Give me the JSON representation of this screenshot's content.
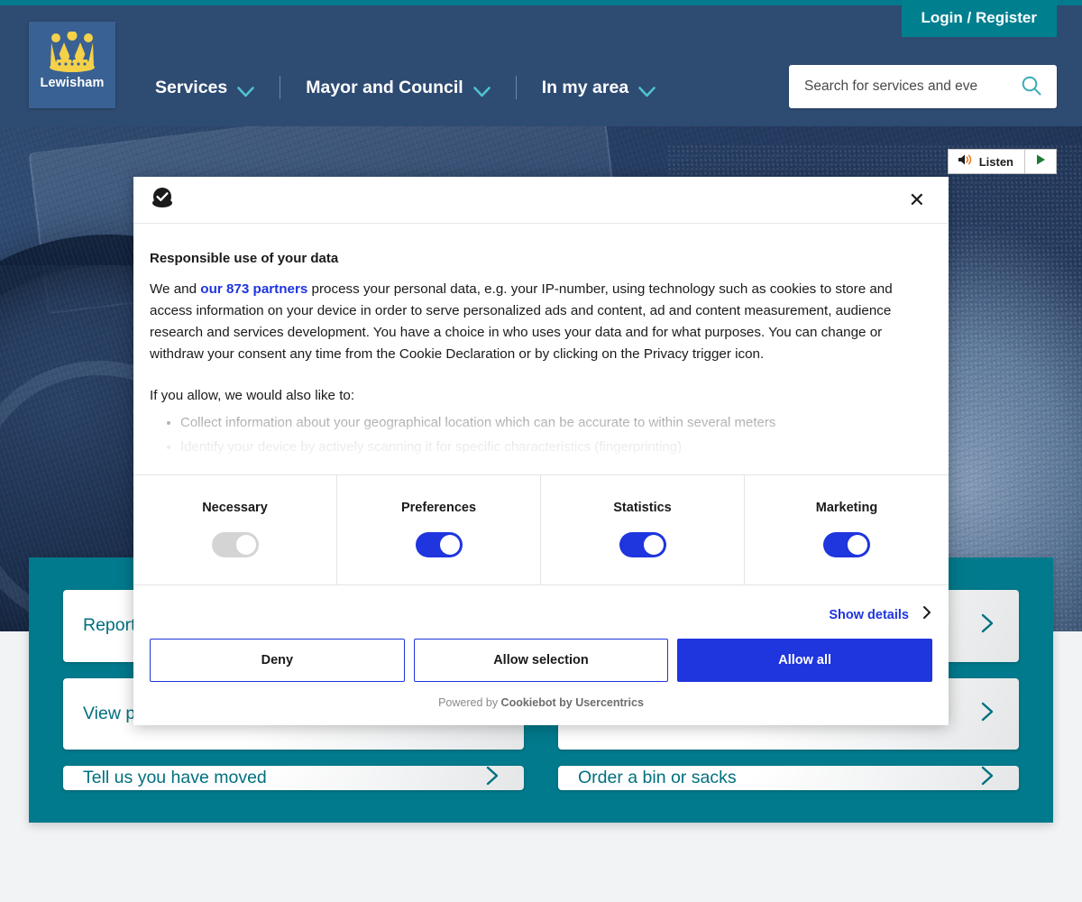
{
  "site": {
    "logo_text": "Lewisham",
    "logo_icon": "crown-icon"
  },
  "header": {
    "login_label": "Login / Register",
    "nav_items": [
      {
        "label": "Services",
        "icon": "chevron-down-icon"
      },
      {
        "label": "Mayor and Council",
        "icon": "chevron-down-icon"
      },
      {
        "label": "In my area",
        "icon": "chevron-down-icon"
      }
    ],
    "search": {
      "placeholder": "Search for services and eve",
      "value": "",
      "icon": "search-icon"
    }
  },
  "hero": {
    "listen": {
      "label": "Listen",
      "speaker_icon": "speaker-icon",
      "play_icon": "play-icon"
    }
  },
  "services": {
    "cards": [
      {
        "label": "Report",
        "icon": "chevron-right-icon"
      },
      {
        "label": "",
        "icon": "chevron-right-icon"
      },
      {
        "label": "View p",
        "icon": "chevron-right-icon"
      },
      {
        "label": "",
        "icon": "chevron-right-icon"
      },
      {
        "label": "Tell us you have moved",
        "icon": "chevron-right-icon"
      },
      {
        "label": "Order a bin or sacks",
        "icon": "chevron-right-icon"
      }
    ]
  },
  "cookie_dialog": {
    "logo_icon": "cookiebot-logo-icon",
    "close_label": "✕",
    "title": "Responsible use of your data",
    "body_prefix": "We and ",
    "partners_link": "our 873 partners",
    "body_suffix": " process your personal data, e.g. your IP-number, using technology such as cookies to store and access information on your device in order to serve personalized ads and content, ad and content measurement, audience research and services development. You have a choice in who uses your data and for what purposes. You can change or withdraw your consent any time from the Cookie Declaration or by clicking on the Privacy trigger icon.",
    "allow_intro": "If you allow, we would also like to:",
    "allow_items": [
      "Collect information about your geographical location which can be accurate to within several meters",
      "Identify your device by actively scanning it for specific characteristics (fingerprinting)"
    ],
    "categories": [
      {
        "label": "Necessary",
        "state": "on",
        "disabled": true
      },
      {
        "label": "Preferences",
        "state": "on",
        "disabled": false
      },
      {
        "label": "Statistics",
        "state": "on",
        "disabled": false
      },
      {
        "label": "Marketing",
        "state": "on",
        "disabled": false
      }
    ],
    "show_details_label": "Show details",
    "show_details_icon": "chevron-right-icon",
    "buttons": {
      "deny": "Deny",
      "allow_selection": "Allow selection",
      "allow_all": "Allow all"
    },
    "powered_prefix": "Powered by ",
    "powered_brand": "Cookiebot by Usercentrics"
  },
  "colors": {
    "navy": "#2e4b72",
    "teal": "#007a8c",
    "teal_login": "#00808f",
    "consent_blue": "#1f35de",
    "card_text": "#00707f",
    "chevron_cyan": "#4fc3ce",
    "crown_yellow": "#f5d14a"
  }
}
